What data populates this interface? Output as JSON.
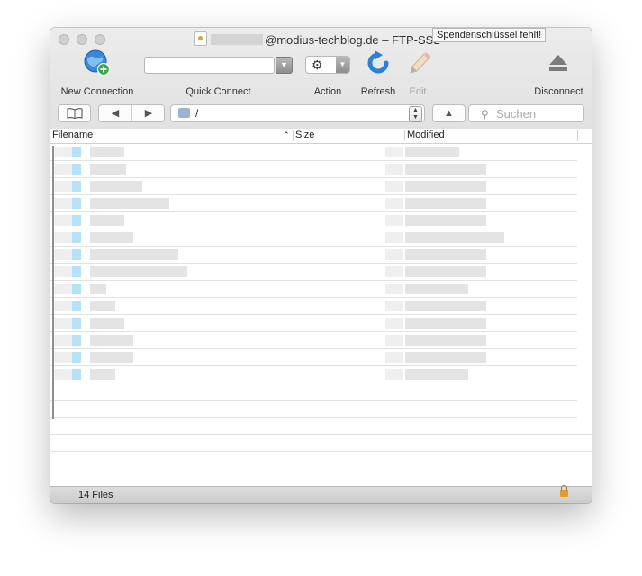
{
  "window": {
    "title": "@modius-techblog.de – FTP-SSL",
    "tooltip": "Spendenschlüssel fehlt!"
  },
  "toolbar": {
    "new_connection": "New Connection",
    "quick_connect": "Quick Connect",
    "quick_connect_value": "",
    "action": "Action",
    "refresh": "Refresh",
    "edit": "Edit",
    "disconnect": "Disconnect"
  },
  "navbar": {
    "path": "/",
    "search_placeholder": "Suchen"
  },
  "columns": {
    "filename": "Filename",
    "size": "Size",
    "modified": "Modified"
  },
  "status": {
    "file_count": "14 Files"
  },
  "icons": {
    "new_connection": "globe-plus-icon",
    "action": "gear-icon",
    "refresh": "refresh-icon",
    "edit": "pencil-icon",
    "disconnect": "eject-icon",
    "bookmarks": "book-icon",
    "back": "triangle-left-icon",
    "forward": "triangle-right-icon",
    "up": "triangle-up-icon",
    "search": "magnifier-icon",
    "secure": "lock-icon"
  },
  "colors": {
    "accent_blue": "#2d80d8",
    "lock_orange": "#e39b2e"
  }
}
